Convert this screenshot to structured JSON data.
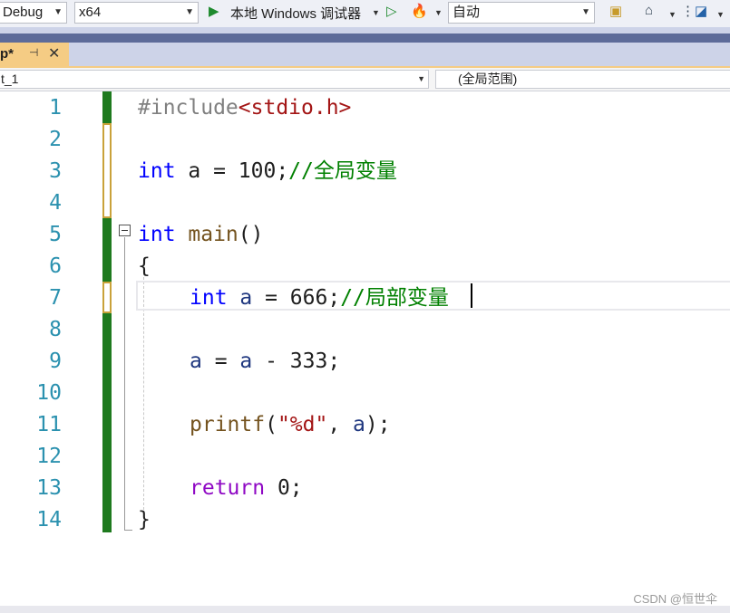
{
  "toolbar": {
    "config": "Debug",
    "platform": "x64",
    "run_label": "本地 Windows 调试器",
    "solution_config": "自动"
  },
  "tab": {
    "name": "p*"
  },
  "navbar": {
    "left": "t_1",
    "right": "(全局范围)"
  },
  "lines": [
    "1",
    "2",
    "3",
    "4",
    "5",
    "6",
    "7",
    "8",
    "9",
    "10",
    "11",
    "12",
    "13",
    "14"
  ],
  "code": {
    "l1_pre": "#include",
    "l1_inc": "<stdio.h>",
    "l3_kw": "int",
    "l3_rest": " a = 100;",
    "l3_cm": "//全局变量",
    "l5_kw": "int",
    "l5_fn": " main",
    "l5_rest": "()",
    "l6": "{",
    "l7_kw": "int",
    "l7_var": " a",
    "l7_rest": " = 666;",
    "l7_cm": "//局部变量",
    "l9_a1": "a",
    "l9_mid": " = ",
    "l9_a2": "a",
    "l9_rest": " - 333;",
    "l11_fn": "printf",
    "l11_p1": "(",
    "l11_str": "\"%d\"",
    "l11_p2": ", ",
    "l11_var": "a",
    "l11_p3": ");",
    "l13_kw": "return",
    "l13_rest": " 0;",
    "l14": "}"
  },
  "watermark": "CSDN @恒世伞",
  "colors": {
    "keyword": "#0000ff",
    "comment": "#008000",
    "line_number": "#2b91af",
    "tab_active": "#f5cc84"
  }
}
